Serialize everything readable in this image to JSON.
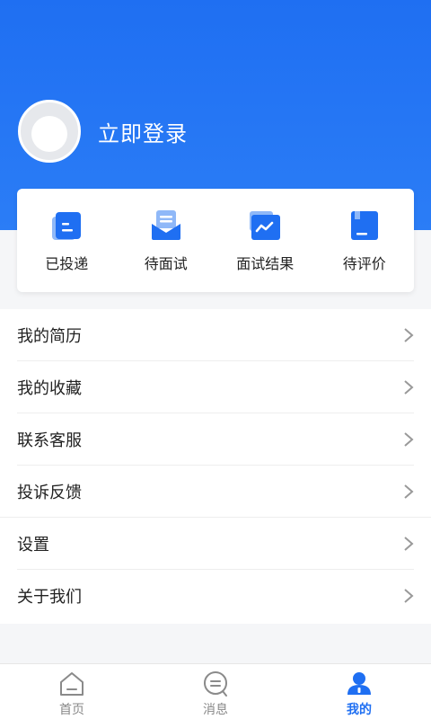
{
  "colors": {
    "primary": "#1f6ff2",
    "text": "#222222",
    "muted": "#888888"
  },
  "profile": {
    "login_text": "立即登录",
    "avatar_icon": "user-avatar-placeholder"
  },
  "status_card": {
    "items": [
      {
        "label": "已投递",
        "icon": "delivered-icon"
      },
      {
        "label": "待面试",
        "icon": "interview-pending-icon"
      },
      {
        "label": "面试结果",
        "icon": "interview-result-icon"
      },
      {
        "label": "待评价",
        "icon": "review-pending-icon"
      }
    ]
  },
  "menu": {
    "items": [
      {
        "label": "我的简历"
      },
      {
        "label": "我的收藏"
      },
      {
        "label": "联系客服"
      },
      {
        "label": "投诉反馈"
      },
      {
        "label": "设置"
      },
      {
        "label": "关于我们"
      }
    ]
  },
  "tabbar": {
    "items": [
      {
        "label": "首页",
        "icon": "home-icon",
        "active": false
      },
      {
        "label": "消息",
        "icon": "message-icon",
        "active": false
      },
      {
        "label": "我的",
        "icon": "profile-icon",
        "active": true
      }
    ]
  }
}
